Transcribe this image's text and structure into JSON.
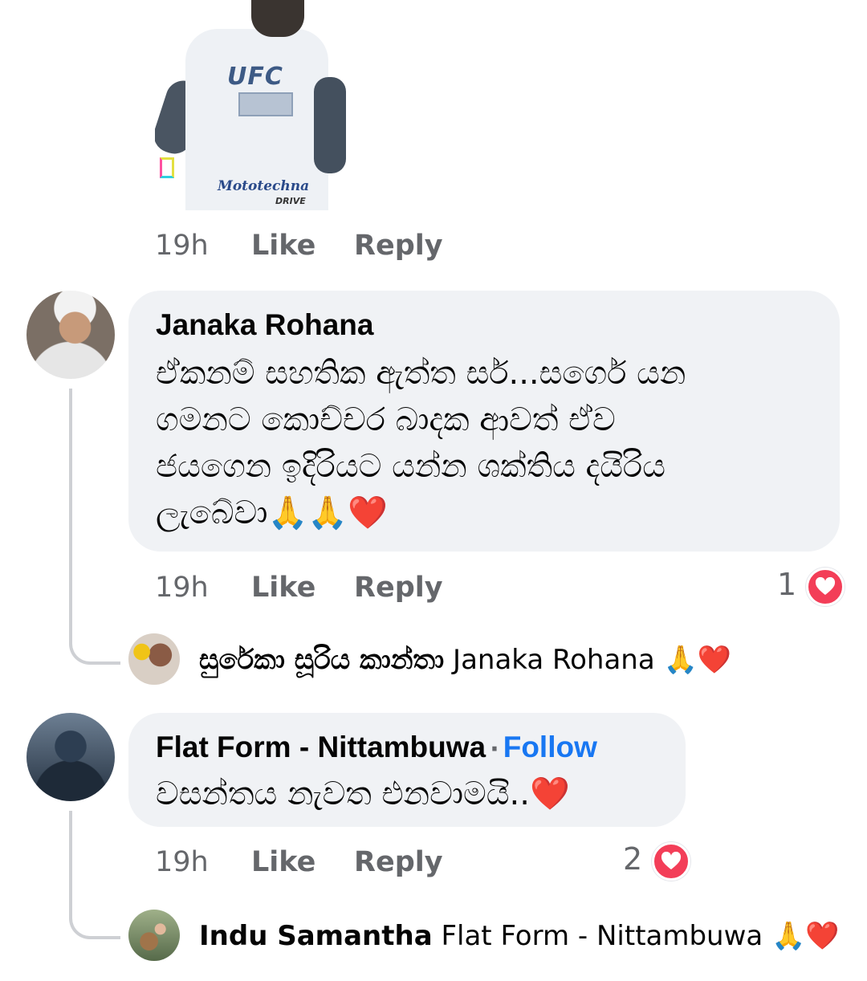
{
  "attachment": {
    "shirt_logo": "UFC",
    "brand": "Mototechna",
    "brand_sub": "DRIVE"
  },
  "comments": [
    {
      "time": "19h",
      "like": "Like",
      "reply": "Reply"
    },
    {
      "author": "Janaka Rohana",
      "text": "ඒකනම් සහතික ඇත්ත සර්...සර්ගෙ යන ගමනට කොච්චර බාදක ආවත් ඒව ජයගෙන ඉදිරියට යන්න ශක්තිය දයිරිය ලැබේවා🙏🙏❤️",
      "text_lines": [
        "ඒකනම් සහතික ඇත්ත සර්...සර්ගෙ යන",
        "ගමනට කොච්චර බාදක ආවත් ඒව",
        "ජයගෙන ඉදිරියට යන්න ශක්තිය දයිරිය",
        "ලැබේවා🙏🙏❤️"
      ],
      "time": "19h",
      "like": "Like",
      "reply": "Reply",
      "reaction_count": "1",
      "reply_preview": {
        "author": "සුරේකා සූරිය කාන්තා",
        "text": "Janaka Rohana 🙏❤️"
      }
    },
    {
      "author": "Flat Form - Nittambuwa",
      "separator": "·",
      "follow": "Follow",
      "text": "වසන්තය නැවත එනවාමයි..❤️",
      "time": "19h",
      "like": "Like",
      "reply": "Reply",
      "reaction_count": "2",
      "reply_preview": {
        "author": "Indu Samantha",
        "text": "Flat Form - Nittambuwa 🙏❤️"
      }
    }
  ],
  "icons": {
    "reaction": "heart-reaction-icon",
    "attachment_badge": "document-icon"
  },
  "colors": {
    "link": "#1877f2",
    "meta": "#65676b",
    "bubble": "#f0f2f5",
    "heart": "#f33e58"
  }
}
